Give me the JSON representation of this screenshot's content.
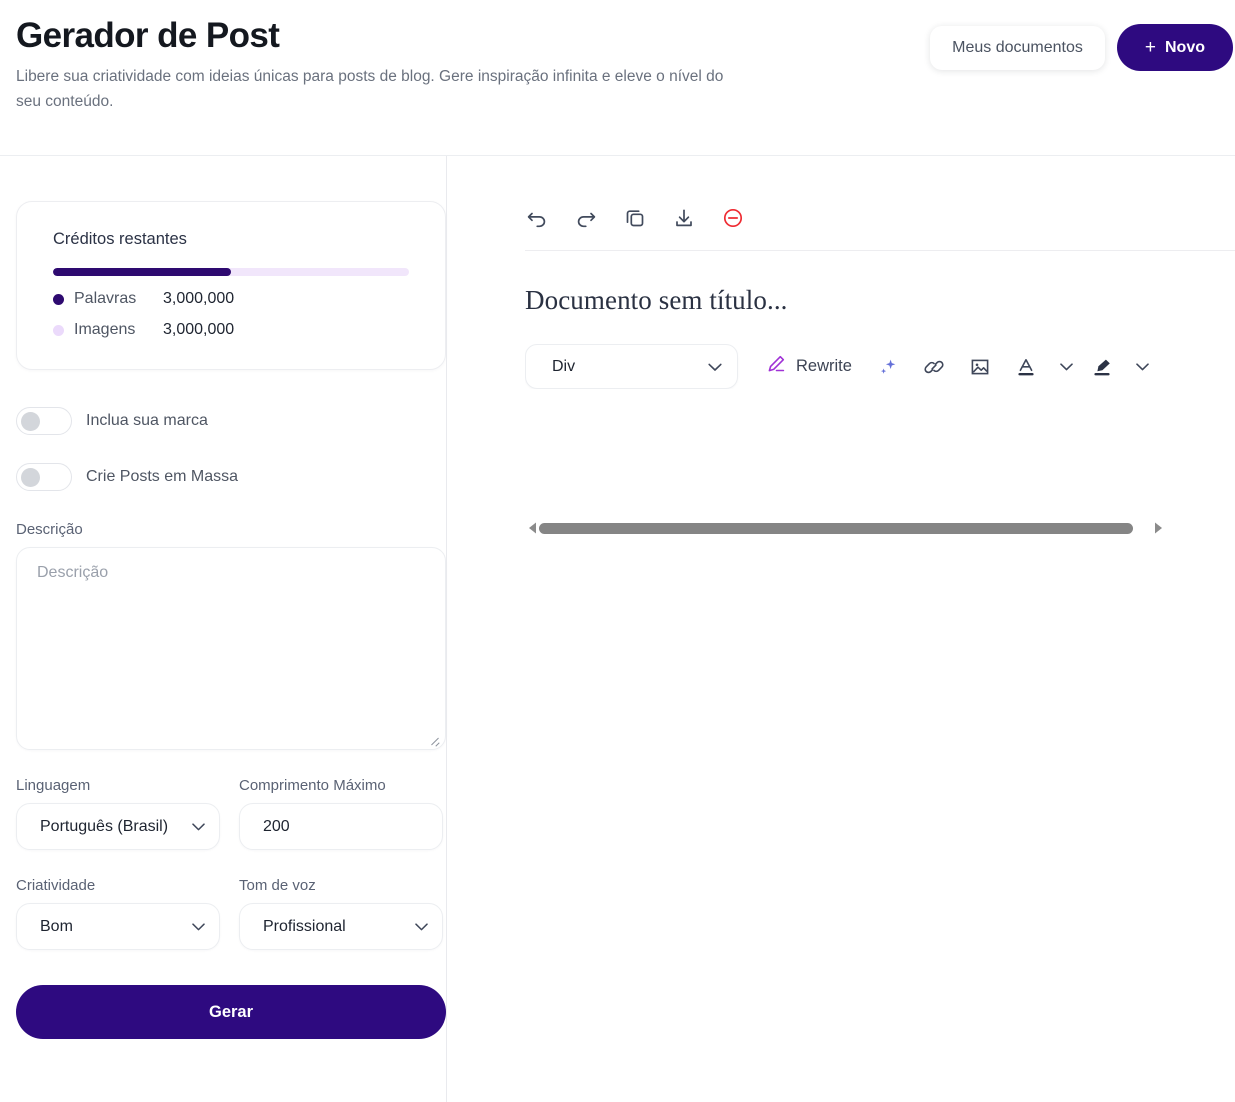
{
  "header": {
    "title": "Gerador de Post",
    "subtitle": "Libere sua criatividade com ideias únicas para posts de blog. Gere inspiração infinita e eleve o nível do seu conteúdo.",
    "my_documents_label": "Meus documentos",
    "new_label": "Novo",
    "new_plus": "+"
  },
  "colors": {
    "brand_purple": "#2E0A80",
    "progress_fill": "#2E0A70",
    "progress_track": "#F1E6FB",
    "words_dot": "#2E0A70",
    "images_dot": "#EBDAFB",
    "danger_red": "#EE2B32",
    "rewrite_purple": "#A032D6",
    "sparkle_blue": "#6470D8"
  },
  "credits": {
    "title": "Créditos restantes",
    "progress_percent": 50,
    "items": [
      {
        "label": "Palavras",
        "value": "3,000,000",
        "dot_color": "#2E0A70"
      },
      {
        "label": "Imagens",
        "value": "3,000,000",
        "dot_color": "#EBDAFB"
      }
    ]
  },
  "toggles": [
    {
      "label": "Inclua sua marca",
      "on": false
    },
    {
      "label": "Crie Posts em Massa",
      "on": false
    }
  ],
  "form": {
    "description": {
      "label": "Descrição",
      "placeholder": "Descrição",
      "value": ""
    },
    "language": {
      "label": "Linguagem",
      "value": "Português (Brasil)"
    },
    "max_length": {
      "label": "Comprimento Máximo",
      "value": "200"
    },
    "creativity": {
      "label": "Criatividade",
      "value": "Bom"
    },
    "tone": {
      "label": "Tom de voz",
      "value": "Profissional"
    },
    "generate_label": "Gerar"
  },
  "editor": {
    "top_tools": [
      {
        "name": "undo-icon",
        "label": "Desfazer"
      },
      {
        "name": "redo-icon",
        "label": "Refazer"
      },
      {
        "name": "copy-icon",
        "label": "Copiar"
      },
      {
        "name": "download-icon",
        "label": "Baixar"
      },
      {
        "name": "clear-icon",
        "label": "Limpar"
      }
    ],
    "document_title": "Documento sem título...",
    "block_type": "Div",
    "rewrite_label": "Rewrite",
    "format_tools": [
      {
        "name": "sparkles-icon"
      },
      {
        "name": "link-icon"
      },
      {
        "name": "image-icon"
      },
      {
        "name": "text-color-icon"
      },
      {
        "name": "chevron-down-icon"
      },
      {
        "name": "highlighter-icon"
      },
      {
        "name": "chevron-down-icon"
      },
      {
        "name": "more-dot-icon"
      }
    ],
    "scrollbar": {
      "left_arrow": "◀",
      "right_arrow": "▶",
      "thumb_percent": 97
    }
  }
}
